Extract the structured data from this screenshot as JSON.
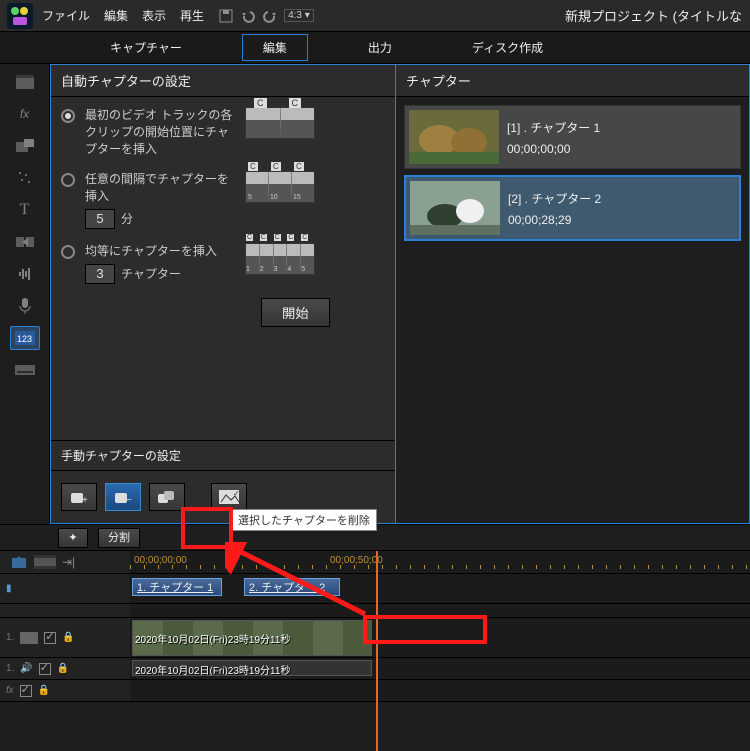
{
  "menu": {
    "file": "ファイル",
    "edit": "編集",
    "view": "表示",
    "play": "再生",
    "aspect": "4:3"
  },
  "title": "新規プロジェクト (タイトルな",
  "tabs": {
    "capture": "キャプチャー",
    "edit": "編集",
    "output": "出力",
    "disc": "ディスク作成"
  },
  "left": {
    "auto_hdr": "自動チャプターの設定",
    "opt1": "最初のビデオ トラックの各クリップの開始位置にチャプターを挿入",
    "opt2": "任意の間隔でチャプターを挿入",
    "opt2_val": "5",
    "opt2_unit": "分",
    "opt3": "均等にチャプターを挿入",
    "opt3_val": "3",
    "opt3_unit": "チャプター",
    "start": "開始",
    "manual_hdr": "手動チャプターの設定",
    "tooltip": "選択したチャプターを削除"
  },
  "right": {
    "hdr": "チャプター",
    "items": [
      {
        "label": "[1] . チャプター 1",
        "tc": "00;00;00;00"
      },
      {
        "label": "[2] . チャプター 2",
        "tc": "00;00;28;29"
      }
    ]
  },
  "under": {
    "split": "分割"
  },
  "ruler": {
    "t0": "00;00;00;00",
    "t1": "00;00;50;00"
  },
  "timeline": {
    "ch1": "1. チャプター 1",
    "ch2": "2. チャプター 2",
    "cliplabel": "2020年10月02日(Fri)23時19分11秒",
    "clipaudio": "2020年10月02日(Fri)23時19分11秒"
  },
  "thumb_ticks": {
    "a": "5",
    "b": "10",
    "c": "15",
    "n1": "1",
    "n2": "2",
    "n3": "3",
    "n4": "4",
    "n5": "5"
  }
}
